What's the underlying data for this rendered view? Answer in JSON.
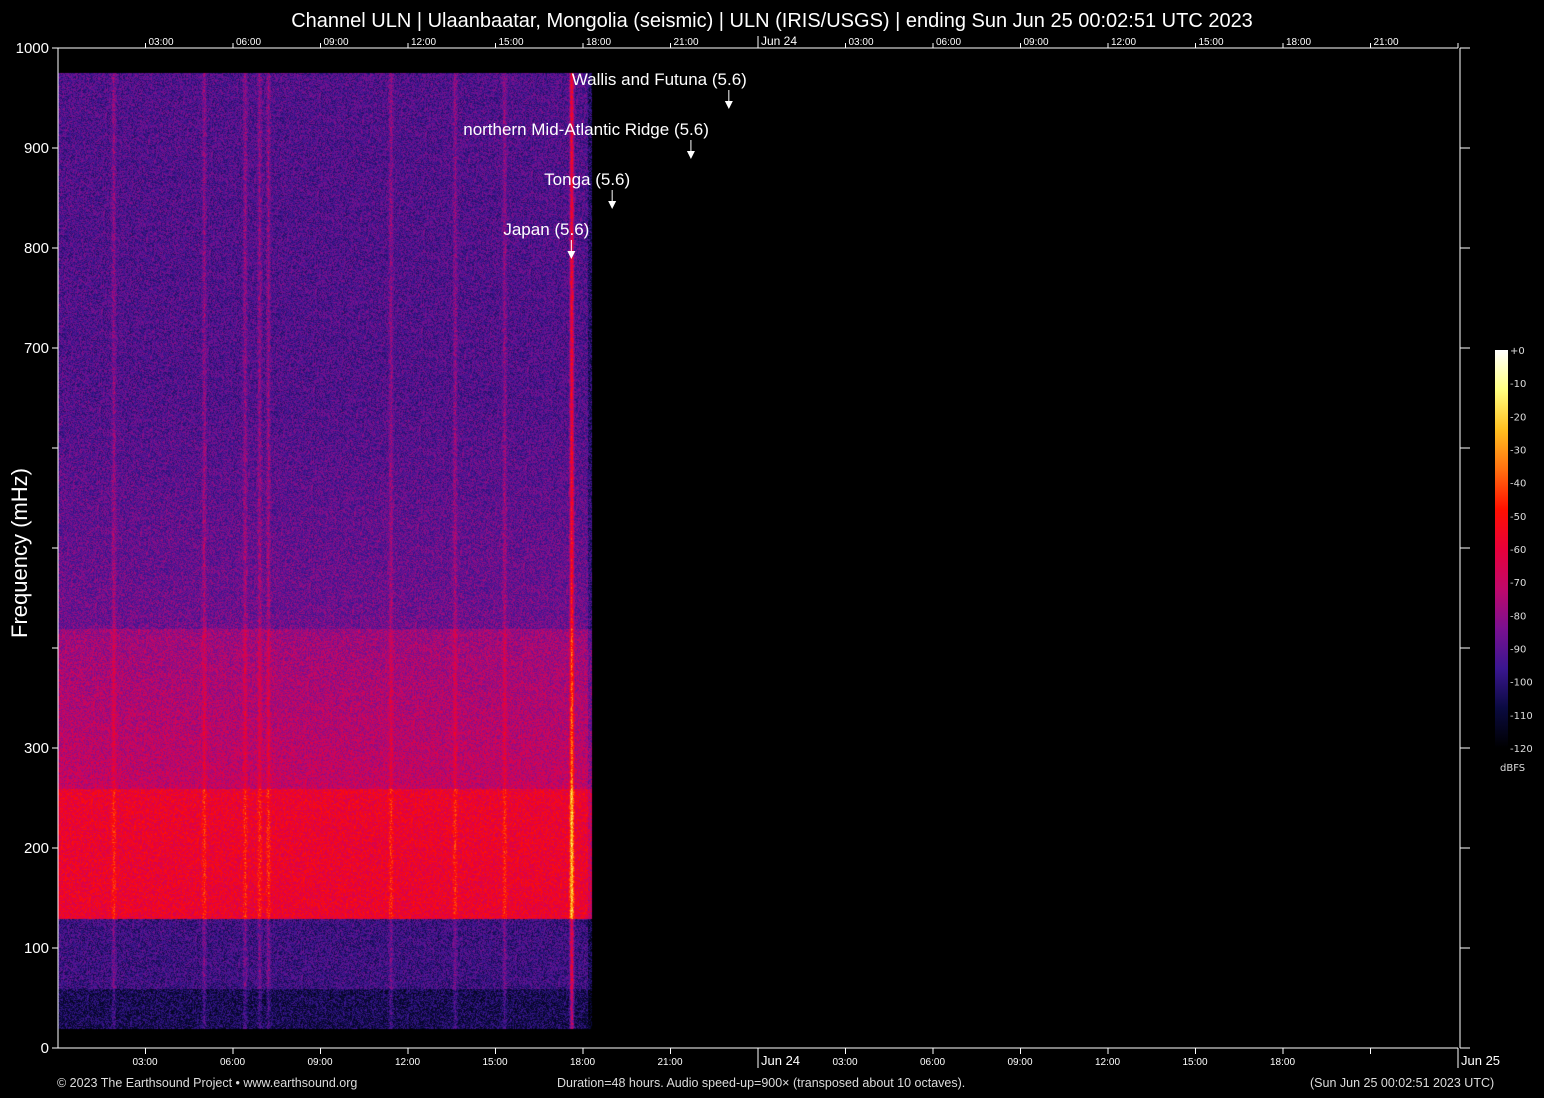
{
  "title": "Channel ULN | Ulaanbaatar, Mongolia (seismic) | ULN (IRIS/USGS) | ending Sun Jun 25 00:02:51 UTC 2023",
  "footer": {
    "copyright": "© 2023 The Earthsound Project • www.earthsound.org",
    "info": "Duration=48 hours. Audio speed-up=900× (transposed about 10 octaves).",
    "end_time": "(Sun Jun 25 00:02:51 2023 UTC)"
  },
  "chart_data": {
    "type": "heatmap",
    "title": "Channel ULN | Ulaanbaatar, Mongolia (seismic) | ULN (IRIS/USGS) | ending Sun Jun 25 00:02:51 UTC 2023",
    "ylabel": "Frequency (mHz)",
    "xlabel": "",
    "xlim_hours": [
      0,
      48
    ],
    "ylim": [
      0,
      1000
    ],
    "y_ticks": [
      0,
      100,
      200,
      300,
      400,
      500,
      600,
      700,
      800,
      900,
      1000
    ],
    "y_tick_labels": [
      "0",
      "100",
      "200",
      "300",
      "",
      "",
      "",
      "700",
      "800",
      "900",
      "1000"
    ],
    "x_ticks_top": [
      {
        "h": 3,
        "label": "03:00"
      },
      {
        "h": 6,
        "label": "06:00"
      },
      {
        "h": 9,
        "label": "09:00"
      },
      {
        "h": 12,
        "label": "12:00"
      },
      {
        "h": 15,
        "label": "15:00"
      },
      {
        "h": 18,
        "label": "18:00"
      },
      {
        "h": 21,
        "label": "21:00"
      },
      {
        "h": 24,
        "label": "Jun 24",
        "major": true
      },
      {
        "h": 27,
        "label": "03:00"
      },
      {
        "h": 30,
        "label": "06:00"
      },
      {
        "h": 33,
        "label": "09:00"
      },
      {
        "h": 36,
        "label": "12:00"
      },
      {
        "h": 39,
        "label": "15:00"
      },
      {
        "h": 42,
        "label": "18:00"
      },
      {
        "h": 45,
        "label": "21:00"
      },
      {
        "h": 48,
        "label": ""
      }
    ],
    "x_ticks_bottom": [
      {
        "h": 3,
        "label": "03:00"
      },
      {
        "h": 6,
        "label": "06:00"
      },
      {
        "h": 9,
        "label": "09:00"
      },
      {
        "h": 12,
        "label": "12:00"
      },
      {
        "h": 15,
        "label": "15:00"
      },
      {
        "h": 18,
        "label": "18:00"
      },
      {
        "h": 21,
        "label": "21:00"
      },
      {
        "h": 24,
        "label": "Jun 24",
        "major": true
      },
      {
        "h": 27,
        "label": "03:00"
      },
      {
        "h": 30,
        "label": "06:00"
      },
      {
        "h": 33,
        "label": "09:00"
      },
      {
        "h": 36,
        "label": "12:00"
      },
      {
        "h": 39,
        "label": "15:00"
      },
      {
        "h": 42,
        "label": "18:00"
      },
      {
        "h": 45,
        "label": ""
      },
      {
        "h": 48,
        "label": "Jun 25",
        "major": true
      }
    ],
    "data_end_hour": 18.3,
    "data_freq_range_mhz": [
      20,
      975
    ],
    "background_db": {
      "high_freq": -92,
      "band_100_400": -70,
      "peak_band_150_250": -58,
      "low_freq_below_60": -105
    },
    "vertical_streaks_hours": [
      1.9,
      5.0,
      6.4,
      6.9,
      7.2,
      11.4,
      13.6,
      15.3,
      17.6
    ],
    "events": [
      {
        "label": "Wallis and Futuna (5.6)",
        "hour": 23.0,
        "freq_mhz": 940
      },
      {
        "label": "northern Mid-Atlantic Ridge (5.6)",
        "hour": 21.7,
        "freq_mhz": 890
      },
      {
        "label": "Tonga (5.6)",
        "hour": 19.0,
        "freq_mhz": 840
      },
      {
        "label": "Japan (5.6)",
        "hour": 17.6,
        "freq_mhz": 790
      }
    ],
    "colorbar": {
      "label": "dBFS",
      "range": [
        -120,
        0
      ],
      "ticks": [
        "+0",
        "-10",
        "-20",
        "-30",
        "-40",
        "-50",
        "-60",
        "-70",
        "-80",
        "-90",
        "-100",
        "-110",
        "-120"
      ],
      "stops": [
        "#000000",
        "#0a0a40",
        "#3a1690",
        "#7a1090",
        "#c0086a",
        "#e8003a",
        "#ff1000",
        "#ff7010",
        "#ffc020",
        "#ffff80",
        "#ffffff"
      ]
    }
  }
}
